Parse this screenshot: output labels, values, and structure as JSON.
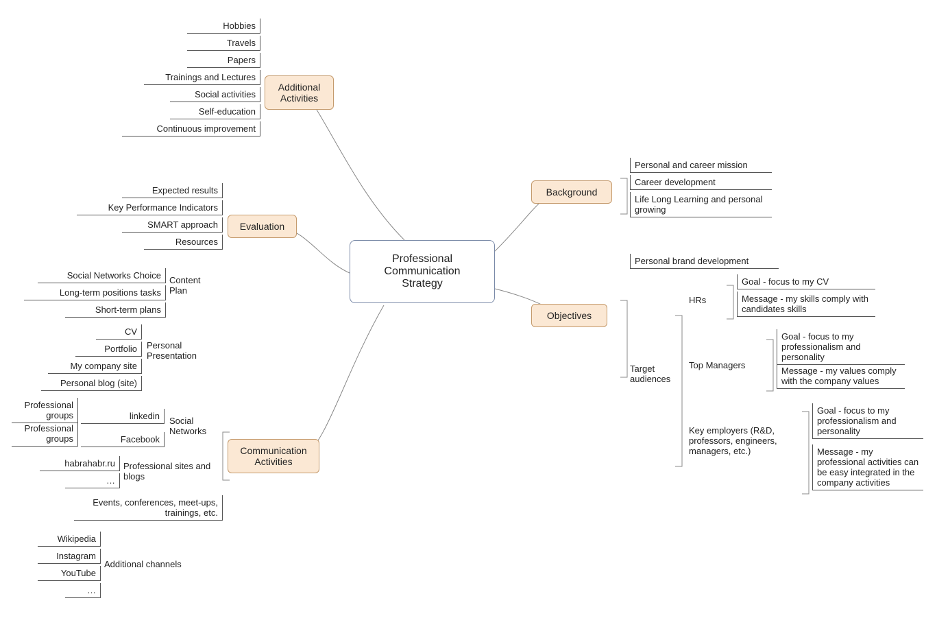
{
  "root": "Professional Communication Strategy",
  "branches": {
    "additional": {
      "label": "Additional Activities",
      "items": [
        "Hobbies",
        "Travels",
        "Papers",
        "Trainings and Lectures",
        "Social activities",
        "Self-education",
        "Continuous improvement"
      ]
    },
    "evaluation": {
      "label": "Evaluation",
      "items": [
        "Expected results",
        "Key Performance Indicators",
        "SMART approach",
        "Resources"
      ]
    },
    "comm": {
      "label": "Communication Activities",
      "groups": {
        "content_plan": {
          "label": "Content Plan",
          "items": [
            "Social Networks Choice",
            "Long-term positions tasks",
            "Short-term plans"
          ]
        },
        "personal_presentation": {
          "label": "Personal Presentation",
          "items": [
            "CV",
            "Portfolio",
            "My company site",
            "Personal blog (site)"
          ]
        },
        "social_networks": {
          "label": "Social Networks",
          "networks": {
            "linkedin": {
              "label": "linkedin",
              "items": [
                "Professional groups"
              ]
            },
            "facebook": {
              "label": "Facebook",
              "items": [
                "Professional groups"
              ]
            }
          }
        },
        "prof_sites": {
          "label": "Professional sites and blogs",
          "items": [
            "habrahabr.ru",
            "…"
          ]
        },
        "events": {
          "label": "Events, conferences, meet-ups, trainings, etc."
        },
        "extra_channels": {
          "label": "Additional channels",
          "items": [
            "Wikipedia",
            "Instagram",
            "YouTube",
            "…"
          ]
        }
      }
    },
    "background": {
      "label": "Background",
      "items": [
        "Personal and career mission",
        "Career development",
        "Life Long Learning and personal growing"
      ]
    },
    "objectives": {
      "label": "Objectives",
      "items": {
        "brand": "Personal brand development",
        "target_label": "Target audiences",
        "hrs": {
          "label": "HRs",
          "goal": "Goal - focus to my CV",
          "msg": "Message - my skills comply with candidates skills"
        },
        "top": {
          "label": "Top Managers",
          "goal": "Goal - focus to my professionalism and personality",
          "msg": "Message - my values comply with the company values"
        },
        "key": {
          "label": "Key employers (R&D, professors, engineers, managers, etc.)",
          "goal": "Goal - focus to my professionalism and personality",
          "msg": "Message - my professional activities can be easy integrated in the company activities"
        }
      }
    }
  }
}
